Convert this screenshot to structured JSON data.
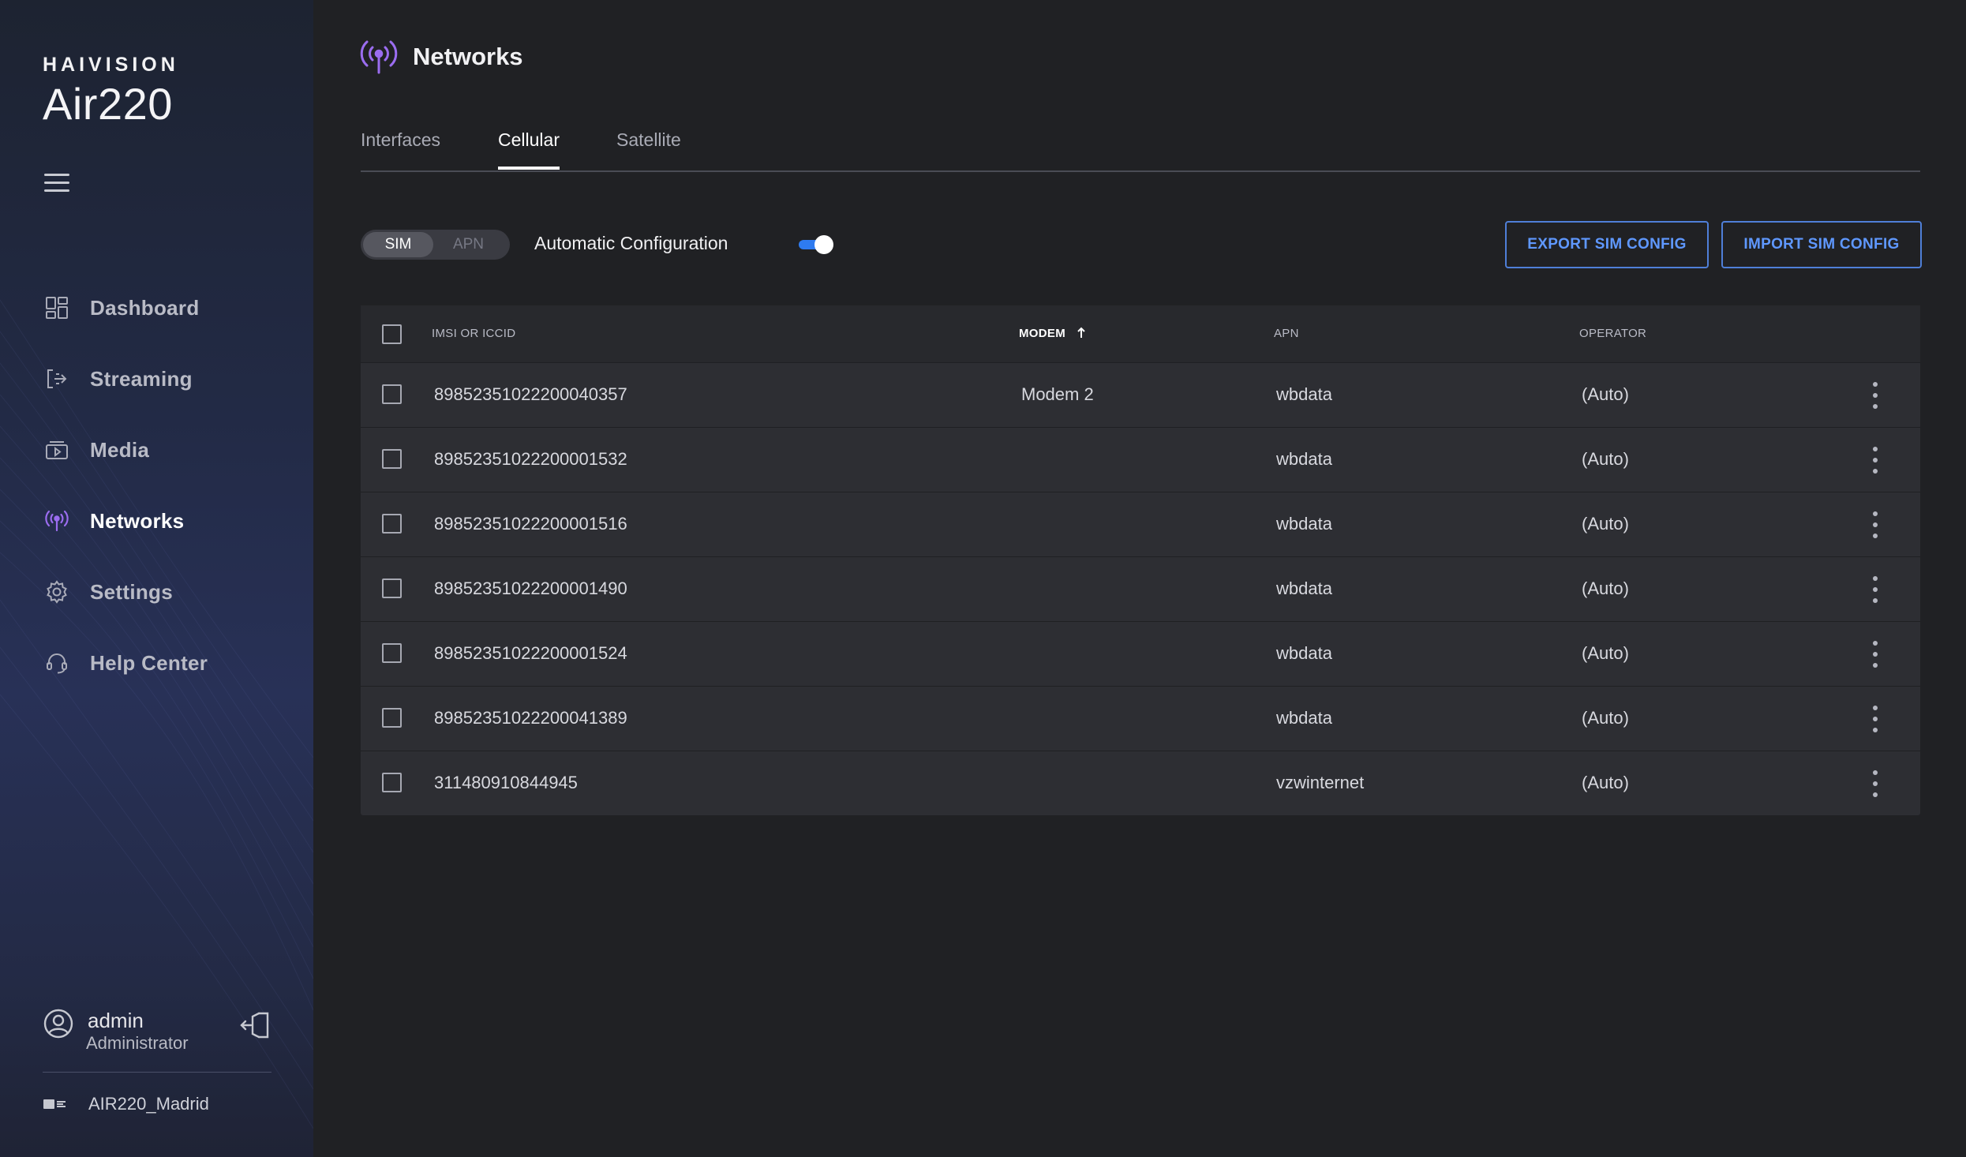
{
  "brand": {
    "company": "HAIVISION",
    "model": "Air220"
  },
  "nav": {
    "items": [
      {
        "label": "Dashboard",
        "icon": "dashboard-icon"
      },
      {
        "label": "Streaming",
        "icon": "streaming-icon"
      },
      {
        "label": "Media",
        "icon": "media-icon"
      },
      {
        "label": "Networks",
        "icon": "networks-icon",
        "active": true
      },
      {
        "label": "Settings",
        "icon": "settings-icon"
      },
      {
        "label": "Help Center",
        "icon": "help-center-icon"
      }
    ]
  },
  "user": {
    "name": "admin",
    "role": "Administrator"
  },
  "device": {
    "name": "AIR220_Madrid"
  },
  "page": {
    "title": "Networks"
  },
  "tabs": [
    {
      "label": "Interfaces"
    },
    {
      "label": "Cellular",
      "active": true
    },
    {
      "label": "Satellite"
    }
  ],
  "toolbar": {
    "segment": {
      "sim": "SIM",
      "apn": "APN",
      "selected": "SIM"
    },
    "auto_config_label": "Automatic Configuration",
    "auto_config_enabled": true,
    "export_label": "EXPORT SIM CONFIG",
    "import_label": "IMPORT SIM CONFIG"
  },
  "table": {
    "headers": {
      "id": "IMSI OR ICCID",
      "modem": "MODEM",
      "apn": "APN",
      "operator": "OPERATOR"
    },
    "sort": {
      "column": "modem",
      "direction": "ascending"
    },
    "rows": [
      {
        "id": "89852351022200040357",
        "modem": "Modem 2",
        "apn": "wbdata",
        "operator": "(Auto)"
      },
      {
        "id": "89852351022200001532",
        "modem": "",
        "apn": "wbdata",
        "operator": "(Auto)"
      },
      {
        "id": "89852351022200001516",
        "modem": "",
        "apn": "wbdata",
        "operator": "(Auto)"
      },
      {
        "id": "89852351022200001490",
        "modem": "",
        "apn": "wbdata",
        "operator": "(Auto)"
      },
      {
        "id": "89852351022200001524",
        "modem": "",
        "apn": "wbdata",
        "operator": "(Auto)"
      },
      {
        "id": "89852351022200041389",
        "modem": "",
        "apn": "wbdata",
        "operator": "(Auto)"
      },
      {
        "id": "311480910844945",
        "modem": "",
        "apn": "vzwinternet",
        "operator": "(Auto)"
      }
    ]
  },
  "colors": {
    "accent": "#9b6df0",
    "button_border": "#4f7fd8",
    "button_text": "#5f98ff",
    "toggle_on": "#2e7bf0"
  }
}
